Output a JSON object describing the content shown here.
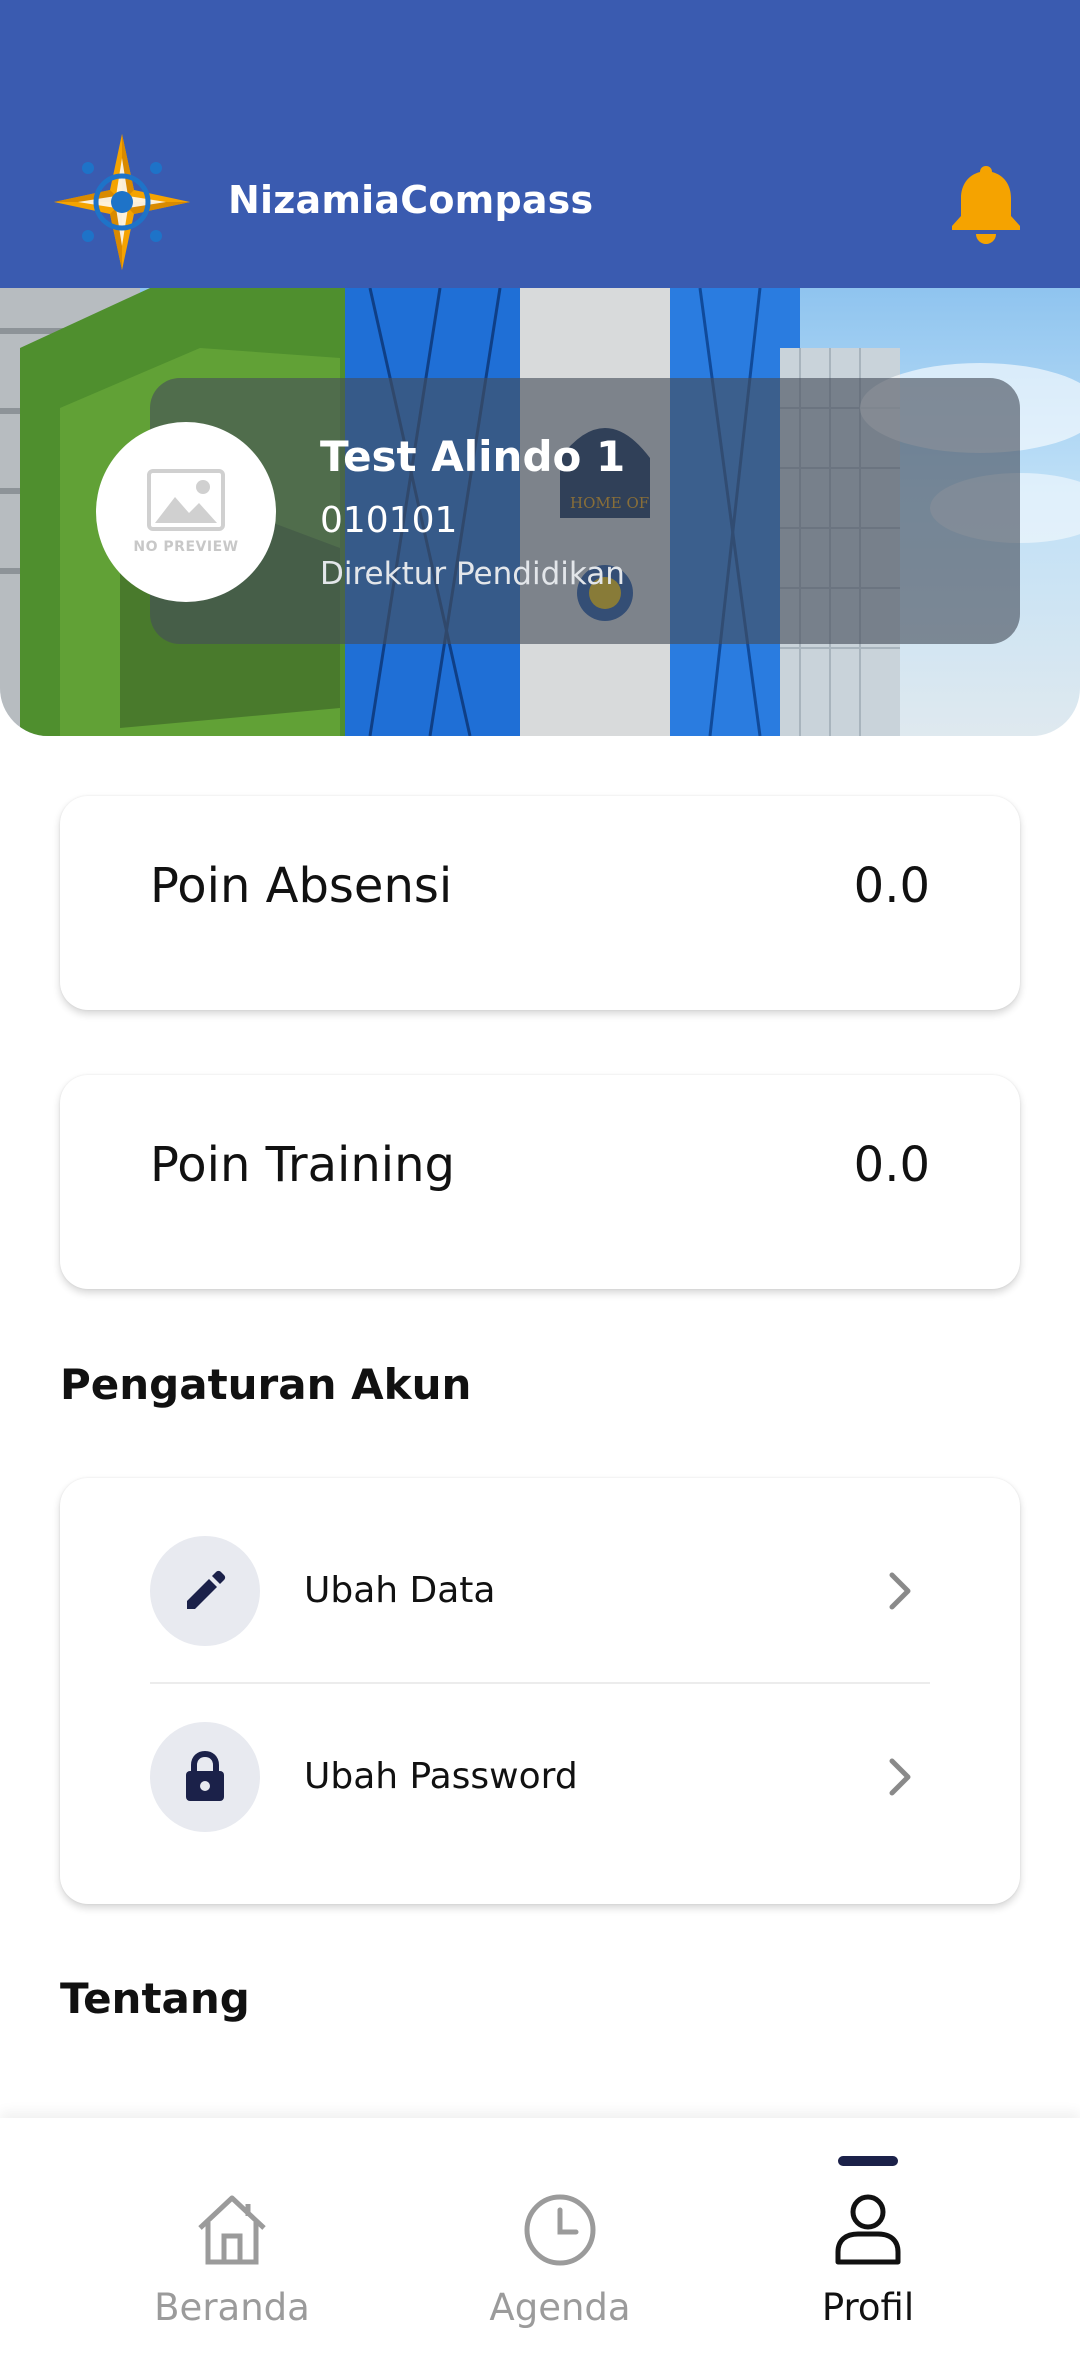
{
  "app": {
    "title": "NizamiaCompass",
    "colors": {
      "primary": "#3a5bb0",
      "notification": "#f5a300",
      "navy": "#1b2149",
      "inactive": "#9b9b9b"
    },
    "icons": {
      "logo": "compass-logo-icon",
      "notification": "bell-icon"
    }
  },
  "profile": {
    "name": "Test Alindo 1",
    "id": "010101",
    "role": "Direktur Pendidikan",
    "avatar_caption": "NO PREVIEW"
  },
  "points": [
    {
      "label": "Poin Absensi",
      "value": "0.0"
    },
    {
      "label": "Poin Training",
      "value": "0.0"
    }
  ],
  "account_settings": {
    "title": "Pengaturan Akun",
    "items": [
      {
        "label": "Ubah Data",
        "icon": "pencil-icon"
      },
      {
        "label": "Ubah Password",
        "icon": "lock-icon"
      }
    ]
  },
  "about": {
    "title": "Tentang"
  },
  "bottom_nav": {
    "items": [
      {
        "label": "Beranda",
        "icon": "home-icon",
        "active": false
      },
      {
        "label": "Agenda",
        "icon": "clock-icon",
        "active": false
      },
      {
        "label": "Profil",
        "icon": "person-icon",
        "active": true
      }
    ]
  }
}
